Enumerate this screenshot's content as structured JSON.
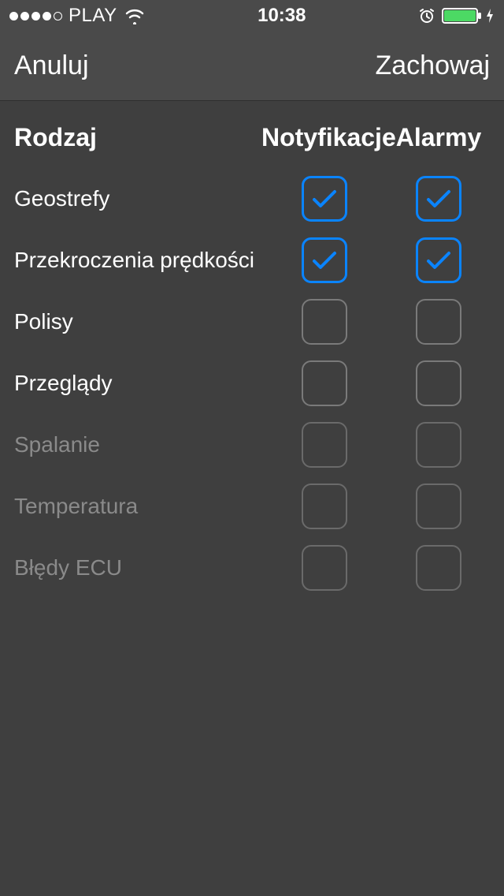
{
  "statusBar": {
    "carrier": "PLAY",
    "time": "10:38"
  },
  "nav": {
    "cancel": "Anuluj",
    "save": "Zachowaj"
  },
  "headers": {
    "type": "Rodzaj",
    "notifications": "Notyfikacje",
    "alarms": "Alarmy"
  },
  "rows": [
    {
      "label": "Geostrefy",
      "notify": true,
      "alarm": true,
      "disabled": false
    },
    {
      "label": "Przekroczenia prędkości",
      "notify": true,
      "alarm": true,
      "disabled": false
    },
    {
      "label": "Polisy",
      "notify": false,
      "alarm": false,
      "disabled": false
    },
    {
      "label": "Przeglądy",
      "notify": false,
      "alarm": false,
      "disabled": false
    },
    {
      "label": "Spalanie",
      "notify": false,
      "alarm": false,
      "disabled": true
    },
    {
      "label": "Temperatura",
      "notify": false,
      "alarm": false,
      "disabled": true
    },
    {
      "label": "Błędy ECU",
      "notify": false,
      "alarm": false,
      "disabled": true
    }
  ]
}
